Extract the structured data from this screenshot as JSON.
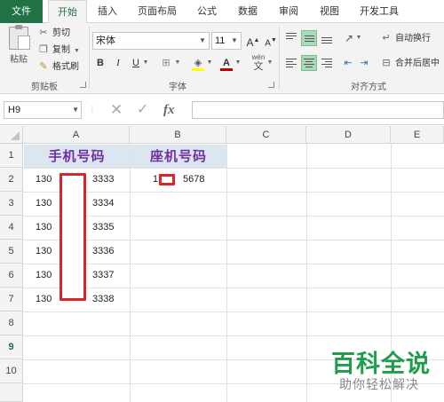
{
  "tabs": [
    "文件",
    "开始",
    "插入",
    "页面布局",
    "公式",
    "数据",
    "审阅",
    "视图",
    "开发工具"
  ],
  "clipboard": {
    "paste": "粘贴",
    "cut": "剪切",
    "copy": "复制",
    "format_painter": "格式刷",
    "group_label": "剪贴板"
  },
  "font": {
    "name": "宋体",
    "size": "11",
    "group_label": "字体",
    "grow": "A",
    "shrink": "A",
    "bold": "B",
    "italic": "I",
    "underline": "U",
    "phonetic": "wén",
    "font_color": "A"
  },
  "alignment": {
    "wrap_text": "自动换行",
    "merge_center": "合并后居中",
    "group_label": "对齐方式"
  },
  "formula_bar": {
    "name_box": "H9",
    "formula": ""
  },
  "columns": [
    "A",
    "B",
    "C",
    "D",
    "E"
  ],
  "rows": [
    "1",
    "2",
    "3",
    "4",
    "5",
    "6",
    "7",
    "8",
    "9",
    "10"
  ],
  "selected_row": "9",
  "sheet": {
    "header_a": "手机号码",
    "header_b": "座机号码",
    "mobile": [
      {
        "prefix": "130",
        "suffix": "3333"
      },
      {
        "prefix": "130",
        "suffix": "3334"
      },
      {
        "prefix": "130",
        "suffix": "3335"
      },
      {
        "prefix": "130",
        "suffix": "3336"
      },
      {
        "prefix": "130",
        "suffix": "3337"
      },
      {
        "prefix": "130",
        "suffix": "3338"
      }
    ],
    "landline": {
      "prefix": "1",
      "suffix": "5678"
    }
  },
  "colors": {
    "accent": "#217346",
    "header_fill": "#dce6f1",
    "header_text": "#7030a0",
    "redaction": "#d9262b",
    "watermark": "#1e9d4b"
  },
  "watermark": {
    "title": "百科全说",
    "subtitle": "助你轻松解决"
  }
}
